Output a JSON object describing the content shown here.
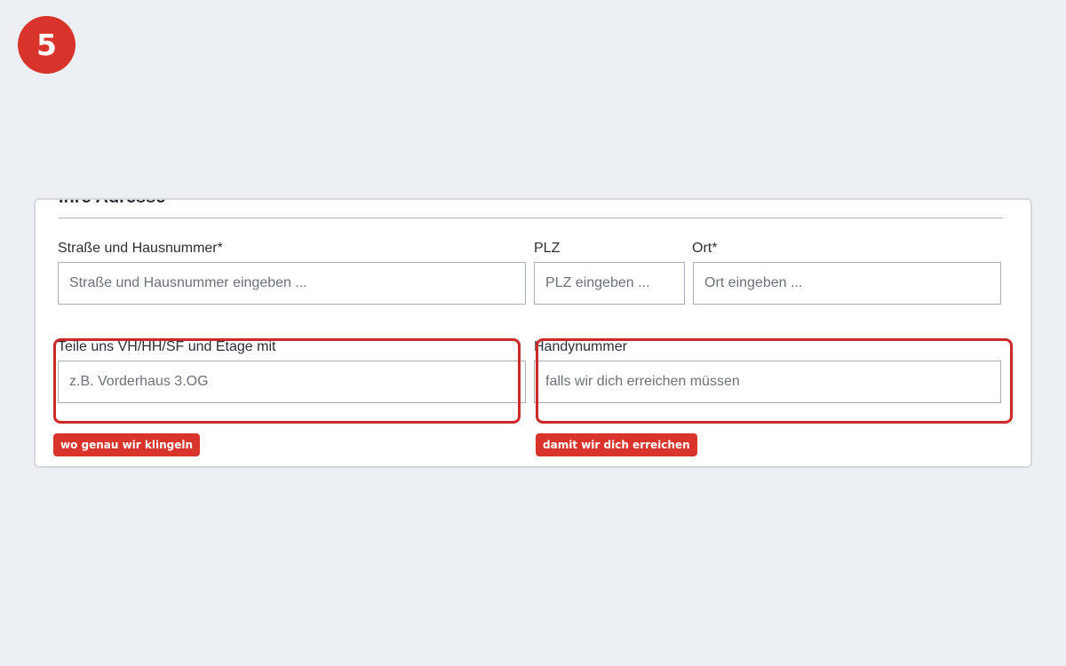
{
  "step_badge": {
    "number": "5"
  },
  "section": {
    "title": "Ihre Adresse"
  },
  "fields": {
    "street": {
      "label": "Straße und Hausnummer*",
      "placeholder": "Straße und Hausnummer eingeben ..."
    },
    "zip": {
      "label": "PLZ",
      "placeholder": "PLZ eingeben ..."
    },
    "city": {
      "label": "Ort*",
      "placeholder": "Ort eingeben ..."
    },
    "floor": {
      "label": "Teile uns VH/HH/SF und Etage mit",
      "placeholder": "z.B. Vorderhaus 3.OG"
    },
    "phone": {
      "label": "Handynummer",
      "placeholder": "falls wir dich erreichen müssen"
    }
  },
  "annotations": {
    "floor_hint": "wo genau wir klingeln",
    "phone_hint": "damit wir dich erreichen"
  },
  "colors": {
    "accent_red": "#D9342B",
    "highlight_red": "#CC2A2A",
    "page_background": "#ECEFF3",
    "input_border": "#A8B1BA"
  }
}
